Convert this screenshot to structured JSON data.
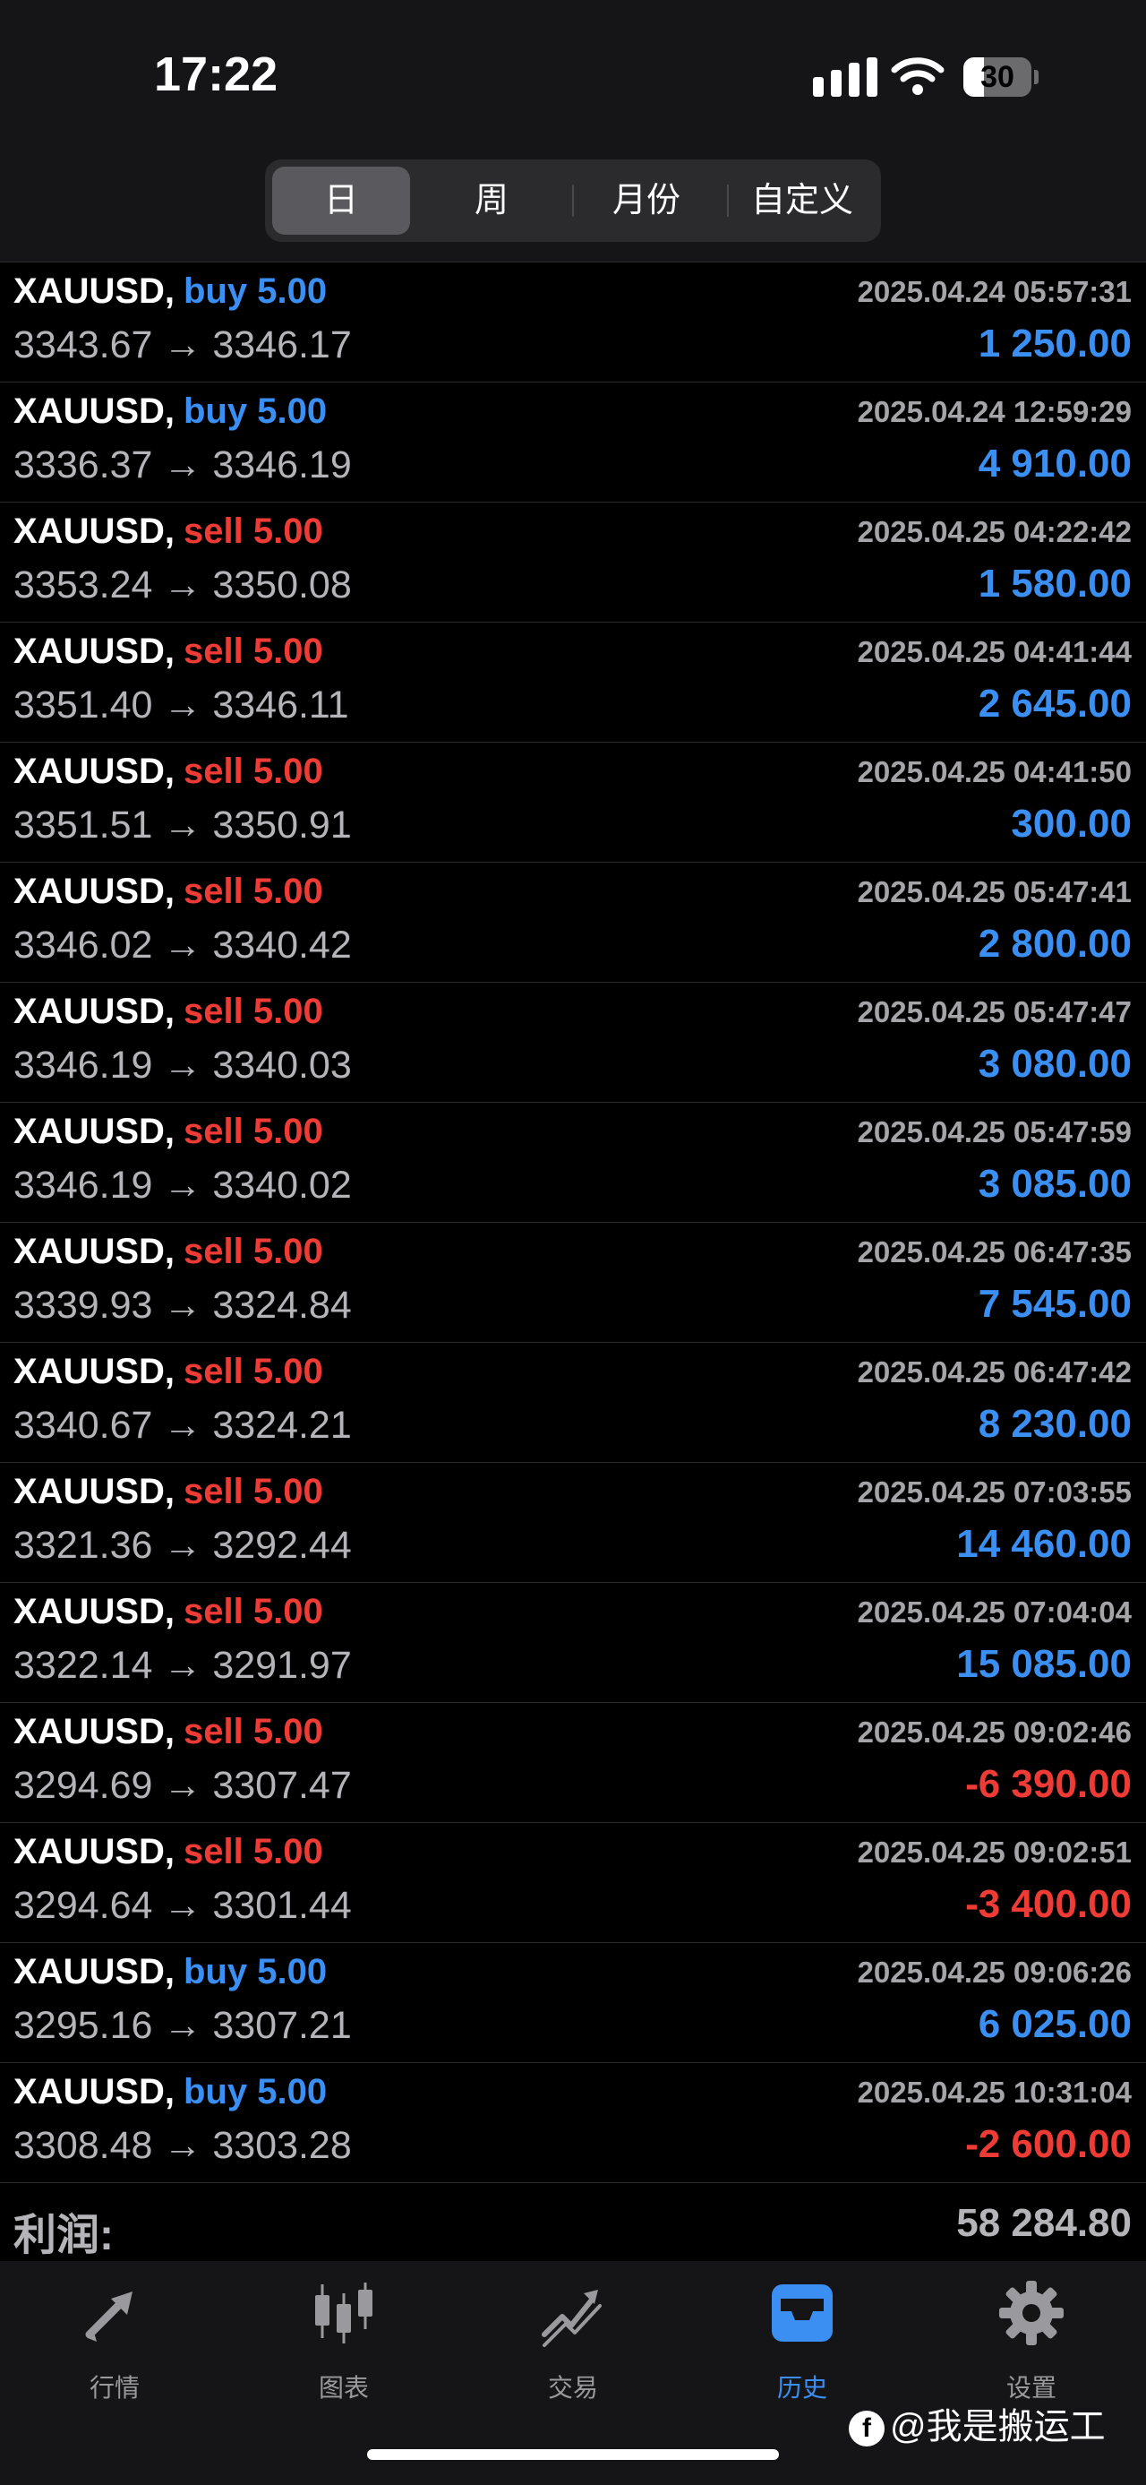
{
  "status_bar": {
    "time": "17:22",
    "battery": "30",
    "battery_level": 0.3
  },
  "period_tabs": [
    {
      "label": "日",
      "active": true
    },
    {
      "label": "周",
      "active": false
    },
    {
      "label": "月份",
      "active": false
    },
    {
      "label": "自定义",
      "active": false
    }
  ],
  "deals": [
    {
      "symbol": "XAUUSD,",
      "type": "buy",
      "volume": "5.00",
      "datetime": "2025.04.24 05:57:31",
      "prices": "3343.67 → 3346.17",
      "profit": "1 250.00",
      "profit_sign": "pos"
    },
    {
      "symbol": "XAUUSD,",
      "type": "buy",
      "volume": "5.00",
      "datetime": "2025.04.24 12:59:29",
      "prices": "3336.37 → 3346.19",
      "profit": "4 910.00",
      "profit_sign": "pos"
    },
    {
      "symbol": "XAUUSD,",
      "type": "sell",
      "volume": "5.00",
      "datetime": "2025.04.25 04:22:42",
      "prices": "3353.24 → 3350.08",
      "profit": "1 580.00",
      "profit_sign": "pos"
    },
    {
      "symbol": "XAUUSD,",
      "type": "sell",
      "volume": "5.00",
      "datetime": "2025.04.25 04:41:44",
      "prices": "3351.40 → 3346.11",
      "profit": "2 645.00",
      "profit_sign": "pos"
    },
    {
      "symbol": "XAUUSD,",
      "type": "sell",
      "volume": "5.00",
      "datetime": "2025.04.25 04:41:50",
      "prices": "3351.51 → 3350.91",
      "profit": "300.00",
      "profit_sign": "pos"
    },
    {
      "symbol": "XAUUSD,",
      "type": "sell",
      "volume": "5.00",
      "datetime": "2025.04.25 05:47:41",
      "prices": "3346.02 → 3340.42",
      "profit": "2 800.00",
      "profit_sign": "pos"
    },
    {
      "symbol": "XAUUSD,",
      "type": "sell",
      "volume": "5.00",
      "datetime": "2025.04.25 05:47:47",
      "prices": "3346.19 → 3340.03",
      "profit": "3 080.00",
      "profit_sign": "pos"
    },
    {
      "symbol": "XAUUSD,",
      "type": "sell",
      "volume": "5.00",
      "datetime": "2025.04.25 05:47:59",
      "prices": "3346.19 → 3340.02",
      "profit": "3 085.00",
      "profit_sign": "pos"
    },
    {
      "symbol": "XAUUSD,",
      "type": "sell",
      "volume": "5.00",
      "datetime": "2025.04.25 06:47:35",
      "prices": "3339.93 → 3324.84",
      "profit": "7 545.00",
      "profit_sign": "pos"
    },
    {
      "symbol": "XAUUSD,",
      "type": "sell",
      "volume": "5.00",
      "datetime": "2025.04.25 06:47:42",
      "prices": "3340.67 → 3324.21",
      "profit": "8 230.00",
      "profit_sign": "pos"
    },
    {
      "symbol": "XAUUSD,",
      "type": "sell",
      "volume": "5.00",
      "datetime": "2025.04.25 07:03:55",
      "prices": "3321.36 → 3292.44",
      "profit": "14 460.00",
      "profit_sign": "pos"
    },
    {
      "symbol": "XAUUSD,",
      "type": "sell",
      "volume": "5.00",
      "datetime": "2025.04.25 07:04:04",
      "prices": "3322.14 → 3291.97",
      "profit": "15 085.00",
      "profit_sign": "pos"
    },
    {
      "symbol": "XAUUSD,",
      "type": "sell",
      "volume": "5.00",
      "datetime": "2025.04.25 09:02:46",
      "prices": "3294.69 → 3307.47",
      "profit": "-6 390.00",
      "profit_sign": "neg"
    },
    {
      "symbol": "XAUUSD,",
      "type": "sell",
      "volume": "5.00",
      "datetime": "2025.04.25 09:02:51",
      "prices": "3294.64 → 3301.44",
      "profit": "-3 400.00",
      "profit_sign": "neg"
    },
    {
      "symbol": "XAUUSD,",
      "type": "buy",
      "volume": "5.00",
      "datetime": "2025.04.25 09:06:26",
      "prices": "3295.16 → 3307.21",
      "profit": "6 025.00",
      "profit_sign": "pos"
    },
    {
      "symbol": "XAUUSD,",
      "type": "buy",
      "volume": "5.00",
      "datetime": "2025.04.25 10:31:04",
      "prices": "3308.48 → 3303.28",
      "profit": "-2 600.00",
      "profit_sign": "neg"
    }
  ],
  "summary": {
    "label": "利润:",
    "value": "58 284.80"
  },
  "bottom_nav": [
    {
      "label": "行情",
      "icon": "quotes-arrows-icon",
      "active": false
    },
    {
      "label": "图表",
      "icon": "candlestick-chart-icon",
      "active": false
    },
    {
      "label": "交易",
      "icon": "trade-chart-icon",
      "active": false
    },
    {
      "label": "历史",
      "icon": "history-inbox-icon",
      "active": true
    },
    {
      "label": "设置",
      "icon": "gear-icon",
      "active": false
    }
  ],
  "watermark": {
    "text": "@我是搬运工",
    "icon": "f"
  },
  "colors": {
    "buy": "#3b8ff3",
    "sell": "#ee3b36",
    "active_nav": "#3b8ff3",
    "inactive_nav": "#9a9a9e"
  }
}
